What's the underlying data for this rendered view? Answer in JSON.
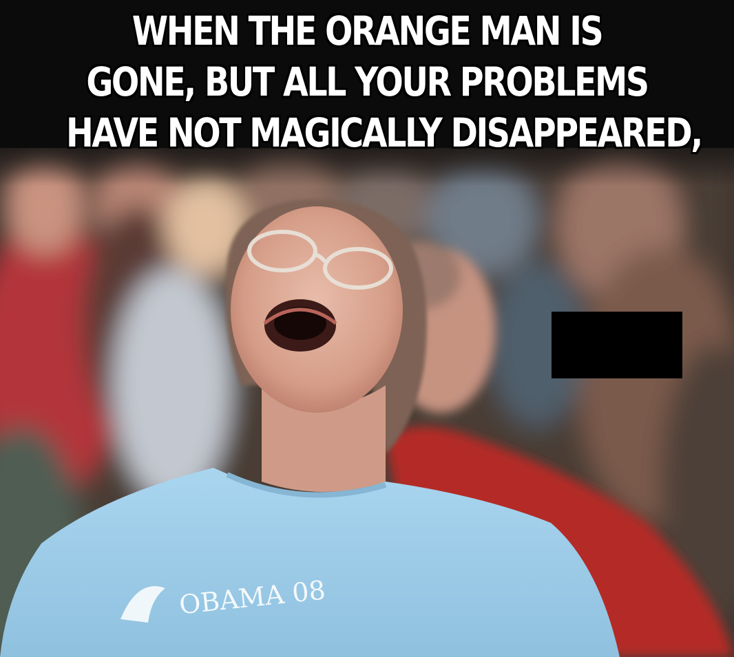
{
  "meme": {
    "caption_lines": [
      "WHEN THE ORANGE MAN IS",
      "GONE, BUT ALL YOUR PROBLEMS",
      "HAVE NOT MAGICALLY DISAPPEARED,"
    ],
    "shirt_text": "OBAMA 08"
  },
  "colors": {
    "caption_top_background": "#0b0b0b",
    "caption_text": "#ffffff",
    "shirt_blue": "#9ecde8",
    "red_shirt": "#b42a28",
    "skin": "#d9a894",
    "redaction_box": "#000000"
  }
}
